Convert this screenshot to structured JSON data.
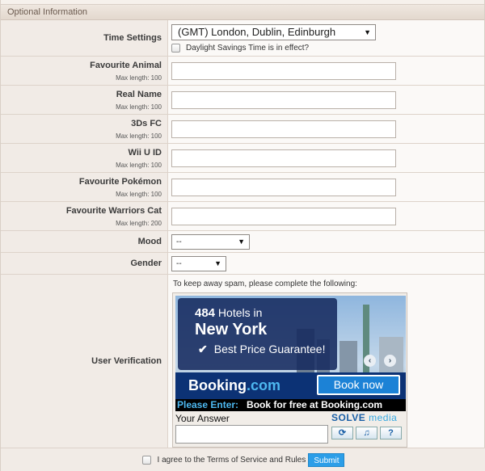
{
  "section": {
    "title": "Optional Information"
  },
  "time_settings": {
    "label": "Time Settings",
    "timezone": "(GMT) London, Dublin, Edinburgh",
    "dst_label": "Daylight Savings Time is in effect?"
  },
  "fields": [
    {
      "label": "Favourite Animal",
      "sub": "Max length: 100"
    },
    {
      "label": "Real Name",
      "sub": "Max length: 100"
    },
    {
      "label": "3Ds FC",
      "sub": "Max length: 100"
    },
    {
      "label": "Wii U ID",
      "sub": "Max length: 100"
    },
    {
      "label": "Favourite Pokémon",
      "sub": "Max length: 100"
    },
    {
      "label": "Favourite Warriors Cat",
      "sub": "Max length: 200"
    }
  ],
  "mood": {
    "label": "Mood",
    "value": "--"
  },
  "gender": {
    "label": "Gender",
    "value": "--"
  },
  "verification": {
    "label": "User Verification",
    "intro": "To keep away spam, please complete the following:",
    "ad": {
      "count": "484",
      "hotels_in": "Hotels in",
      "city": "New York",
      "guarantee": "Best Price Guarantee!",
      "logo_main": "Booking",
      "logo_dot": ".com",
      "book_now": "Book now",
      "please_enter": "Please Enter:",
      "phrase": "Book for free at Booking.com"
    },
    "answer_label": "Your Answer",
    "solve_brand": "SOLVE",
    "solve_media": "media"
  },
  "footer": {
    "agree": "I agree to the Terms of Service and Rules",
    "submit": "Submit"
  },
  "colors": {
    "accent": "#2c9ee8",
    "booking_blue": "#0c3275"
  }
}
